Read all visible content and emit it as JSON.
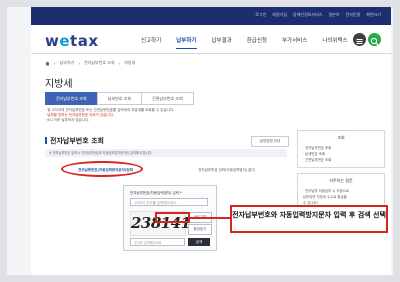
{
  "top_links": [
    "로그인",
    "회원가입",
    "장애인정보서비스",
    "일본어",
    "전자민원",
    "화면크기"
  ],
  "logo": {
    "pre": "w",
    "dot": "e",
    "post": "tax"
  },
  "menu": [
    {
      "label": "신고하기",
      "active": false
    },
    {
      "label": "납부하기",
      "active": true
    },
    {
      "label": "납부결과",
      "active": false
    },
    {
      "label": "환급신청",
      "active": false
    },
    {
      "label": "부가서비스",
      "active": false
    },
    {
      "label": "나의위택스",
      "active": false
    }
  ],
  "colors": {
    "navy": "#1b2e6e",
    "blue": "#3f63b5",
    "red": "#d7261e",
    "menu_btn": "#3c4043",
    "search_btn": "#2aa84a"
  },
  "breadcrumb": [
    "납부하기",
    "전자납부번호 조회",
    "지방세"
  ],
  "page_title": "지방세",
  "tabs": [
    "전자납부번호 조회",
    "납세번호 조회",
    "간편납부번호 조회"
  ],
  "notice_lines": [
    "· 위 고지서의 전자납부번호 또는 간편납부번호를 입력하여 지방세를 조회할 수 있습니다.",
    "· 납부할 장부는 전자납부번호 이외가 있습니다.",
    "· 6시 이후 납부하지 않습니다."
  ],
  "section_title": "전자납부번호 조회",
  "help_button": "납부방법 안내",
  "sub_notice": "※ 전자납부번호 입력시 전자납부번호와 자동입력방지문자를 입력해야 합니다.",
  "radio_options": [
    "전자납부번호(자동입력방지문자)입력",
    "전자납부번호 입력(자동입력방지) 없이"
  ],
  "form": {
    "label": "전자납부번호(자동입력방지) 입력 *",
    "placeholder": "19자리 숫자를 입력해주세요.",
    "captcha_text": "238141",
    "refresh_label": "새로고침",
    "audio_label": "음성듣기",
    "captcha_placeholder": "숫자를 입력해주세요",
    "search_label": "검색"
  },
  "callout_text": "전자납부번호와 자동입력방지문자 입력 후 검색 선택",
  "aside": {
    "box1_title": "조회",
    "box1_items": [
      "· 전자납부번호 조회",
      "· 납세번호 조회",
      "· 간편납부번호 조회"
    ],
    "box2_title": "자주하는 질문",
    "box2_items": [
      "· 전자납부 자동납부 시 자동으로",
      "  납부되면 지방세 수수료 환급을",
      "  수 있나요?",
      "· 자동이체를 납부하기 위해 어떻게?",
      "· 신용카드로 납부할 수 있나요?",
      "· 각종 세금을 납부하려고 하는데"
    ]
  }
}
